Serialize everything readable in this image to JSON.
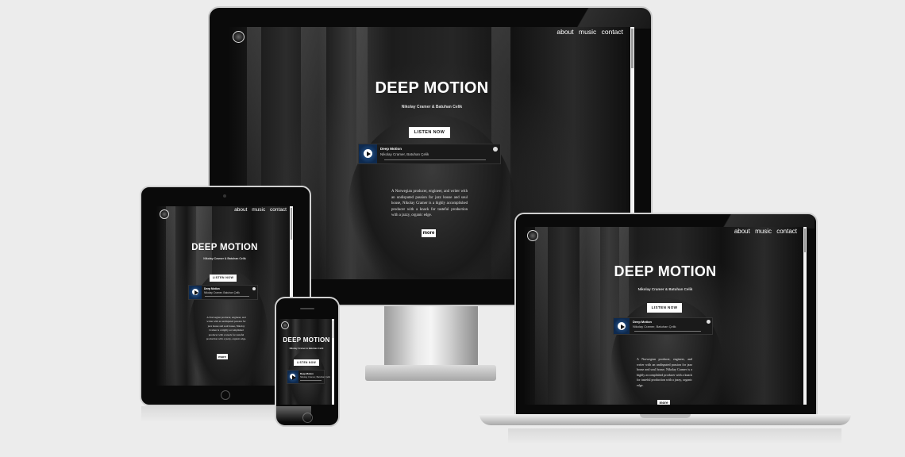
{
  "site": {
    "nav": [
      "about",
      "music",
      "contact"
    ],
    "hero_title": "DEEP MOTION",
    "hero_subtitle": "Nikolay Cramer & Batuhan Celik",
    "listen_button": "LISTEN NOW",
    "bio": "A Norwegian producer, engineer, and writer with an undisputed passion for jazz house and soul house, Nikolay Cramer is a highly accomplished producer with a knack for tasteful production with a jazzy, organic edge.",
    "more_button": "more"
  },
  "player": {
    "track_title": "Deep Motion",
    "track_artist": "Nikolay Cramer, Batuhan Çelik"
  },
  "devices": [
    "desktop",
    "tablet",
    "phone",
    "laptop"
  ],
  "colors": {
    "background": "#ececec",
    "screen": "#1a1a1a",
    "accent_player": "#1e4a80"
  }
}
